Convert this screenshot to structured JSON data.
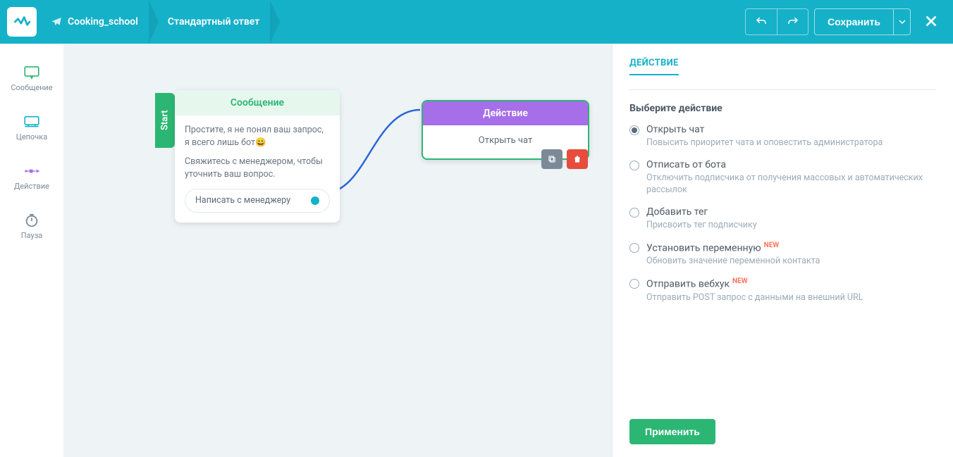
{
  "header": {
    "bot_name": "Cooking_school",
    "flow_name": "Стандартный ответ",
    "save_label": "Сохранить"
  },
  "tools": {
    "message": "Сообщение",
    "chain": "Цепочка",
    "action": "Действие",
    "pause": "Пауза"
  },
  "canvas": {
    "start_label": "Start",
    "message_node": {
      "title": "Сообщение",
      "text1": "Простите, я не понял ваш запрос, я всего лишь бот😀",
      "text2": "Свяжитесь с менеджером, чтобы уточнить ваш вопрос.",
      "quick_reply": "Написать с менеджеру"
    },
    "action_node": {
      "title": "Действие",
      "body": "Открыть чат"
    }
  },
  "panel": {
    "title": "ДЕЙСТВИЕ",
    "subhead": "Выберите действие",
    "options": [
      {
        "label": "Открыть чат",
        "desc": "Повысить приоритет чата и оповестить администратора",
        "selected": true,
        "new": false
      },
      {
        "label": "Отписать от бота",
        "desc": "Отключить подписчика от получения массовых и автоматических рассылок",
        "selected": false,
        "new": false
      },
      {
        "label": "Добавить тег",
        "desc": "Присвоить тег подписчику",
        "selected": false,
        "new": false
      },
      {
        "label": "Установить переменную",
        "desc": "Обновить значение переменной контакта",
        "selected": false,
        "new": true
      },
      {
        "label": "Отправить вебхук",
        "desc": "Отправить POST запрос с данными на внешний URL",
        "selected": false,
        "new": true
      }
    ],
    "new_badge": "NEW",
    "apply_label": "Применить"
  }
}
